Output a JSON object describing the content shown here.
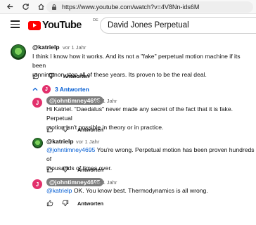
{
  "browser": {
    "url": "https://www.youtube.com/watch?v=4V8Nn-ids6M"
  },
  "header": {
    "logo_text": "YouTube",
    "logo_region": "DE",
    "search_value": "David Jones Perpetual"
  },
  "comment": {
    "author": "@katrielp",
    "time": "vor 1 Jahr",
    "text_lines": [
      "I think I know how it works. And its not a \"fake\" perpetual motion machine if its been",
      "running non-stop all of these years. Its proven to be the real deal."
    ],
    "reply_label": "Antworten",
    "replies_count_label": "3 Antworten",
    "replies_avatar_letter": "J"
  },
  "replies": [
    {
      "author": "@johntimney4695",
      "avatar_letter": "J",
      "time": "vor 1 Jahr",
      "mention": "",
      "text_lines": [
        "Hi Katriel.  \"Daedalus\" never made any secret of the fact that it is fake.  Perpetual",
        "motion isn't possible in theory or in practice."
      ],
      "reply_label": "Antworten"
    },
    {
      "author": "@katrielp",
      "time": "vor 1 Jahr",
      "mention": "@johntimney4695",
      "text_lines": [
        " You're wrong. Perpetual motion has been proven hundreds of",
        "thousands of times over."
      ],
      "reply_label": "Antworten"
    },
    {
      "author": "@johntimney4695",
      "avatar_letter": "J",
      "time": "vor 1 Jahr",
      "mention": "@katrielp",
      "text_lines": [
        " OK.  You know best.  Thermodynamics is all wrong."
      ],
      "reply_label": "Antworten"
    }
  ]
}
